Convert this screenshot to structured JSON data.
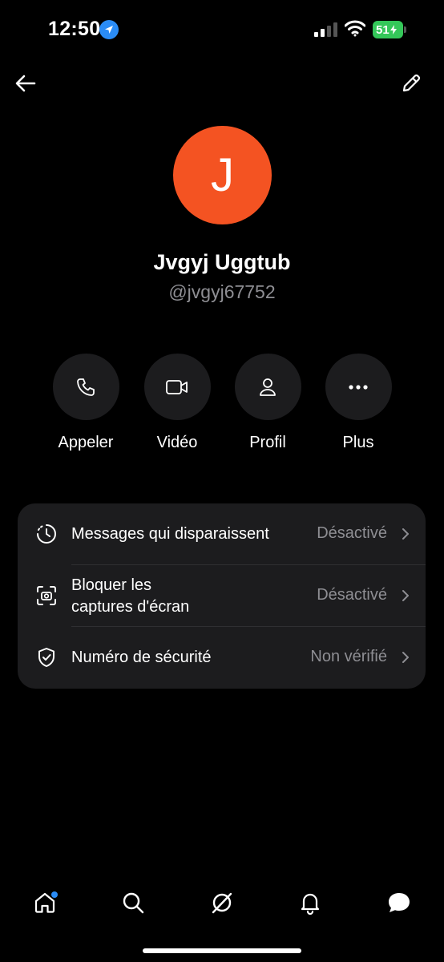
{
  "status_bar": {
    "time": "12:50",
    "battery": "51"
  },
  "contact": {
    "initial": "J",
    "name": "Jvgyj Uggtub",
    "handle": "@jvgyj67752",
    "avatar_color": "#f45322"
  },
  "actions": [
    {
      "label": "Appeler",
      "icon": "phone-icon"
    },
    {
      "label": "Vidéo",
      "icon": "video-icon"
    },
    {
      "label": "Profil",
      "icon": "person-icon"
    },
    {
      "label": "Plus",
      "icon": "more-icon"
    }
  ],
  "settings": [
    {
      "label": "Messages qui disparaissent",
      "value": "Désactivé",
      "icon": "timer-icon"
    },
    {
      "label_line1": "Bloquer les",
      "label_line2": "captures d'écran",
      "value": "Désactivé",
      "icon": "screenshot-block-icon"
    },
    {
      "label": "Numéro de sécurité",
      "value": "Non vérifié",
      "icon": "shield-check-icon"
    }
  ],
  "tabbar": [
    {
      "icon": "home-icon",
      "badge": true
    },
    {
      "icon": "search-icon"
    },
    {
      "icon": "explore-icon"
    },
    {
      "icon": "bell-icon"
    },
    {
      "icon": "chat-icon"
    }
  ],
  "colors": {
    "background": "#000000",
    "card": "#1c1c1e",
    "secondary_text": "#8e8e93",
    "accent": "#2a8cf6"
  }
}
